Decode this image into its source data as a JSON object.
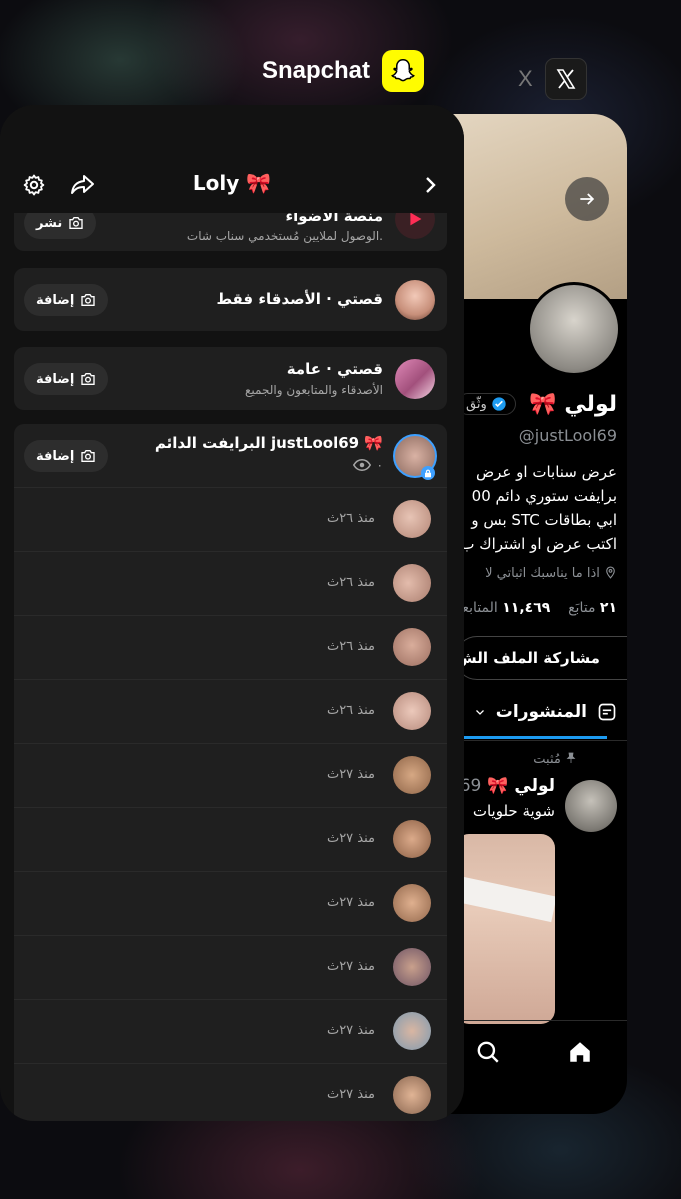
{
  "switcher": {
    "snapchat_label": "Snapchat",
    "x_label": "X"
  },
  "x_app": {
    "name": "لولي 🎀",
    "verified_partial": "وثّق",
    "handle": "@justLool69",
    "bio_lines": [
      "عرض سنابات او عرض",
      "برايفت ستوري دائم 00",
      "ابي بطاقات STC بس و",
      "اكتب عرض او اشتراك ب"
    ],
    "location": "اذا ما يناسبك اثباتي لا",
    "following_count": "٢١",
    "following_label": "متابَع",
    "followers_count": "١١,٤٦٩",
    "followers_label": "المتابعون",
    "share_button": "مشاركة الملف الش",
    "posts_tab": "المنشورات",
    "pinned_label": "مُثبت",
    "post_author": "لولي 🎀",
    "post_handle_partial": "69",
    "post_text": "شوية حلويات"
  },
  "snapchat": {
    "title": "Loly 🎀",
    "spotlight": {
      "title": "منصة الأضواء",
      "subtitle": "الوصول لملايين مُستخدمي سناب شات.",
      "action": "نشر"
    },
    "friends_story": {
      "title": "قصتي · الأصدقاء فقط",
      "action": "إضافة"
    },
    "public_story": {
      "title": "قصتي · عامة",
      "subtitle": "الأصدقاء والمتابعون والجميع",
      "action": "إضافة"
    },
    "private_story": {
      "title": "البرايفت الدائم justLool69 🎀",
      "views": "٠",
      "action": "إضافة"
    },
    "snaps": [
      {
        "time": "منذ ٢٦ث"
      },
      {
        "time": "منذ ٢٦ث"
      },
      {
        "time": "منذ ٢٦ث"
      },
      {
        "time": "منذ ٢٦ث"
      },
      {
        "time": "منذ ٢٧ث"
      },
      {
        "time": "منذ ٢٧ث"
      },
      {
        "time": "منذ ٢٧ث"
      },
      {
        "time": "منذ ٢٧ث"
      },
      {
        "time": "منذ ٢٧ث"
      },
      {
        "time": "منذ ٢٧ث"
      }
    ]
  },
  "colors": {
    "snap_yellow": "#fffc00",
    "x_blue": "#1d9bf0",
    "card_bg": "#121212",
    "row_bg": "#1f1f1f"
  }
}
